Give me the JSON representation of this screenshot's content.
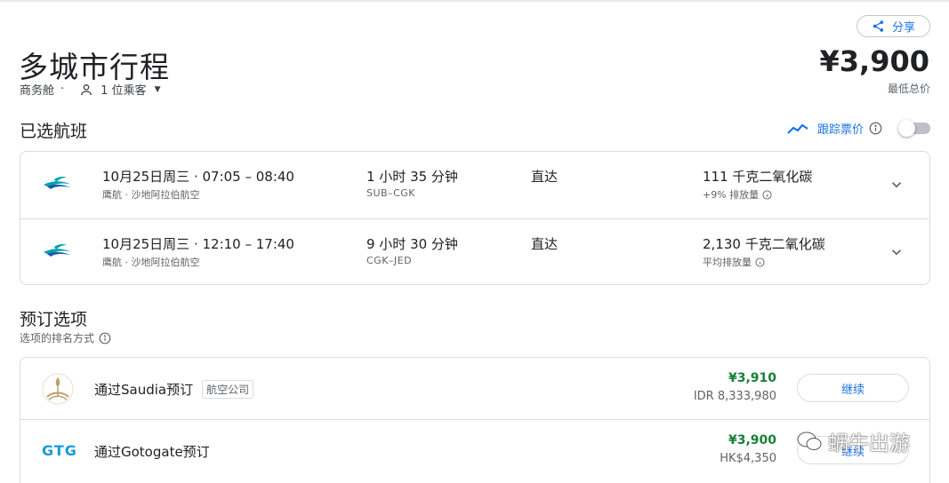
{
  "header": {
    "share_label": "分享",
    "title": "多城市行程",
    "cabin": "商务舱",
    "separator": "·",
    "passengers": "1 位乘客",
    "total_price": "¥3,900",
    "price_caption": "最低总价"
  },
  "selected": {
    "title": "已选航班",
    "track_label": "跟踪票价",
    "track_enabled": false
  },
  "flights": [
    {
      "times": "10月25日周三 · 07:05 – 08:40",
      "airline": "鹰航 · 沙地阿拉伯航空",
      "duration": "1 小时 35 分钟",
      "route": "SUB–CGK",
      "stops": "直达",
      "emission": "111 千克二氧化碳",
      "emission_note": "+9% 排放量"
    },
    {
      "times": "10月25日周三 · 12:10 – 17:40",
      "airline": "鹰航 · 沙地阿拉伯航空",
      "duration": "9 小时 30 分钟",
      "route": "CGK–JED",
      "stops": "直达",
      "emission": "2,130 千克二氧化碳",
      "emission_note": "平均排放量"
    }
  ],
  "booking": {
    "title": "预订选项",
    "sort_label": "选项的排名方式",
    "options": [
      {
        "vendor": "通过Saudia预订",
        "tag": "航空公司",
        "price": "¥3,910",
        "alt_price": "IDR 8,333,980",
        "button": "继续"
      },
      {
        "logo_text": "GTG",
        "vendor": "通过Gotogate预订",
        "price": "¥3,900",
        "alt_price": "HK$4,350",
        "button": "继续"
      }
    ]
  },
  "watermark": "蜗牛出游",
  "colors": {
    "accent": "#1a73e8",
    "price_green": "#188038",
    "border": "#dadce0",
    "secondary_text": "#5f6368"
  }
}
